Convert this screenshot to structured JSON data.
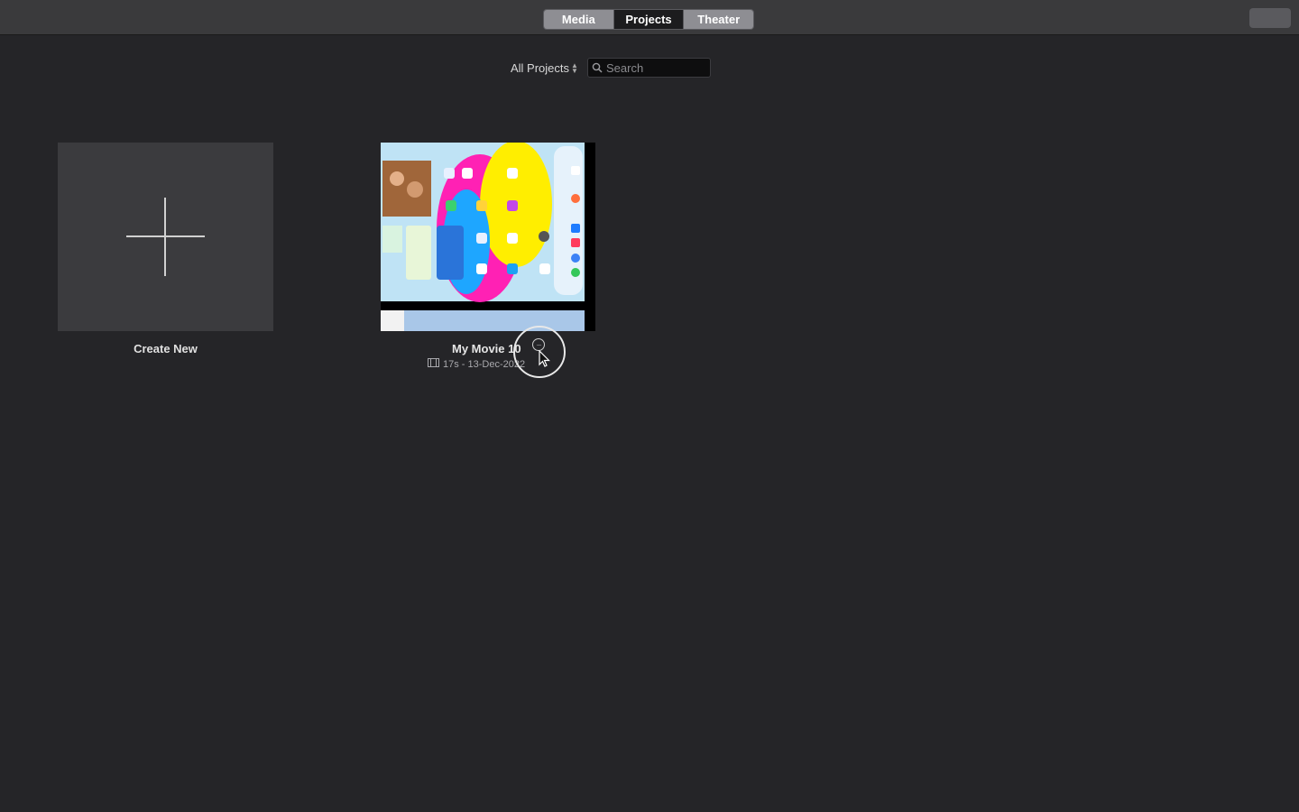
{
  "toolbar": {
    "tabs": [
      {
        "label": "Media",
        "active": false
      },
      {
        "label": "Projects",
        "active": true
      },
      {
        "label": "Theater",
        "active": false
      }
    ]
  },
  "browser": {
    "filter_label": "All Projects",
    "search_placeholder": "Search"
  },
  "projects": {
    "create_new_label": "Create New",
    "items": [
      {
        "title": "My Movie 10",
        "meta": "17s - 13-Dec-2022",
        "more_icon": "ellipsis-circle-icon"
      }
    ]
  },
  "colors": {
    "background": "#252528",
    "toolbar": "#3a3a3c",
    "tab_inactive": "#8e8e93",
    "tab_active": "#1c1c1e"
  }
}
